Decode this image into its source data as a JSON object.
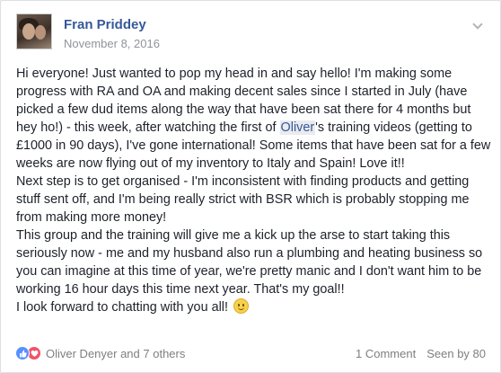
{
  "post": {
    "author": "Fran Priddey",
    "date": "November 8, 2016",
    "body": {
      "p1_a": "Hi everyone! Just wanted to pop my head in and say hello! I'm making some progress with RA and OA and making decent sales since I started in July (have picked a few dud items along the way that have been sat there for 4 months but hey ho!) - this week, after watching the first of ",
      "mention": "Oliver",
      "p1_b": "'s training videos (getting to £1000 in 90 days), I've gone international! Some items that have been sat for a few weeks are now flying out of my inventory to Italy and Spain! Love it!!",
      "p2": "Next step is to get organised - I'm inconsistent with finding products and getting stuff sent off, and I'm being really strict with BSR which is probably stopping me from making more money!",
      "p3": "This group and the training will give me a kick up the arse to start taking this seriously now - me and my husband also run a plumbing and heating business so you can imagine at this time of year, we're pretty manic and I don't want him to be working 16 hour days this time next year. That's my goal!!",
      "p4": "I look forward to chatting with you all!"
    },
    "emoji": "smile-emoji"
  },
  "footer": {
    "reactions": [
      "like",
      "love"
    ],
    "reactors": "Oliver Denyer and 7 others",
    "comments": "1 Comment",
    "seen": "Seen by 80"
  },
  "colors": {
    "link": "#365899",
    "text": "#1d2129",
    "muted": "#90949c",
    "like": "#5890ff",
    "love": "#f25268"
  }
}
